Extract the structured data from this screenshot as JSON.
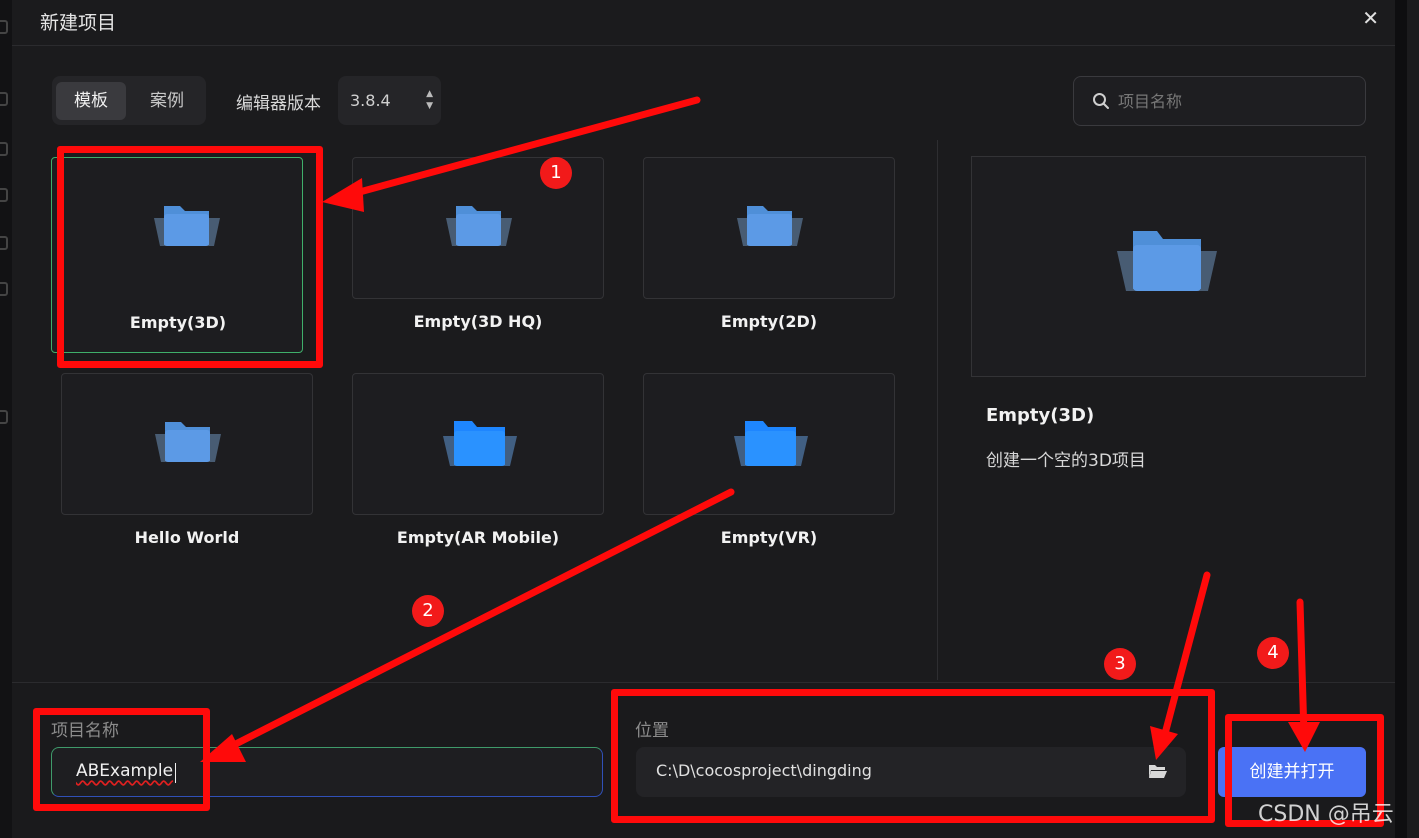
{
  "dialog": {
    "title": "新建项目"
  },
  "toolbar": {
    "tabs": [
      "模板",
      "案例"
    ],
    "active_tab": "模板",
    "editor_version_label": "编辑器版本",
    "editor_version": "3.8.4",
    "search_placeholder": "项目名称"
  },
  "templates": [
    {
      "name": "Empty(3D)",
      "selected": true
    },
    {
      "name": "Empty(3D HQ)",
      "selected": false
    },
    {
      "name": "Empty(2D)",
      "selected": false
    },
    {
      "name": "Hello World",
      "selected": false
    },
    {
      "name": "Empty(AR Mobile)",
      "selected": false
    },
    {
      "name": "Empty(VR)",
      "selected": false
    }
  ],
  "preview": {
    "title": "Empty(3D)",
    "description": "创建一个空的3D项目"
  },
  "form": {
    "name_label": "项目名称",
    "name_value": "ABExample",
    "location_label": "位置",
    "location_value": "C:\\D\\cocosproject\\dingding",
    "create_button": "创建并打开"
  },
  "annotations": {
    "steps": [
      "1",
      "2",
      "3",
      "4"
    ],
    "color": "#ff0a0a"
  },
  "watermark": "CSDN @吊云",
  "colors": {
    "accent": "#4a72f5",
    "selected_border": "#3fae6a",
    "folder": "#4f8fd8"
  },
  "icons": {
    "close": "close-icon",
    "search": "search-icon",
    "folder": "folder-icon"
  }
}
